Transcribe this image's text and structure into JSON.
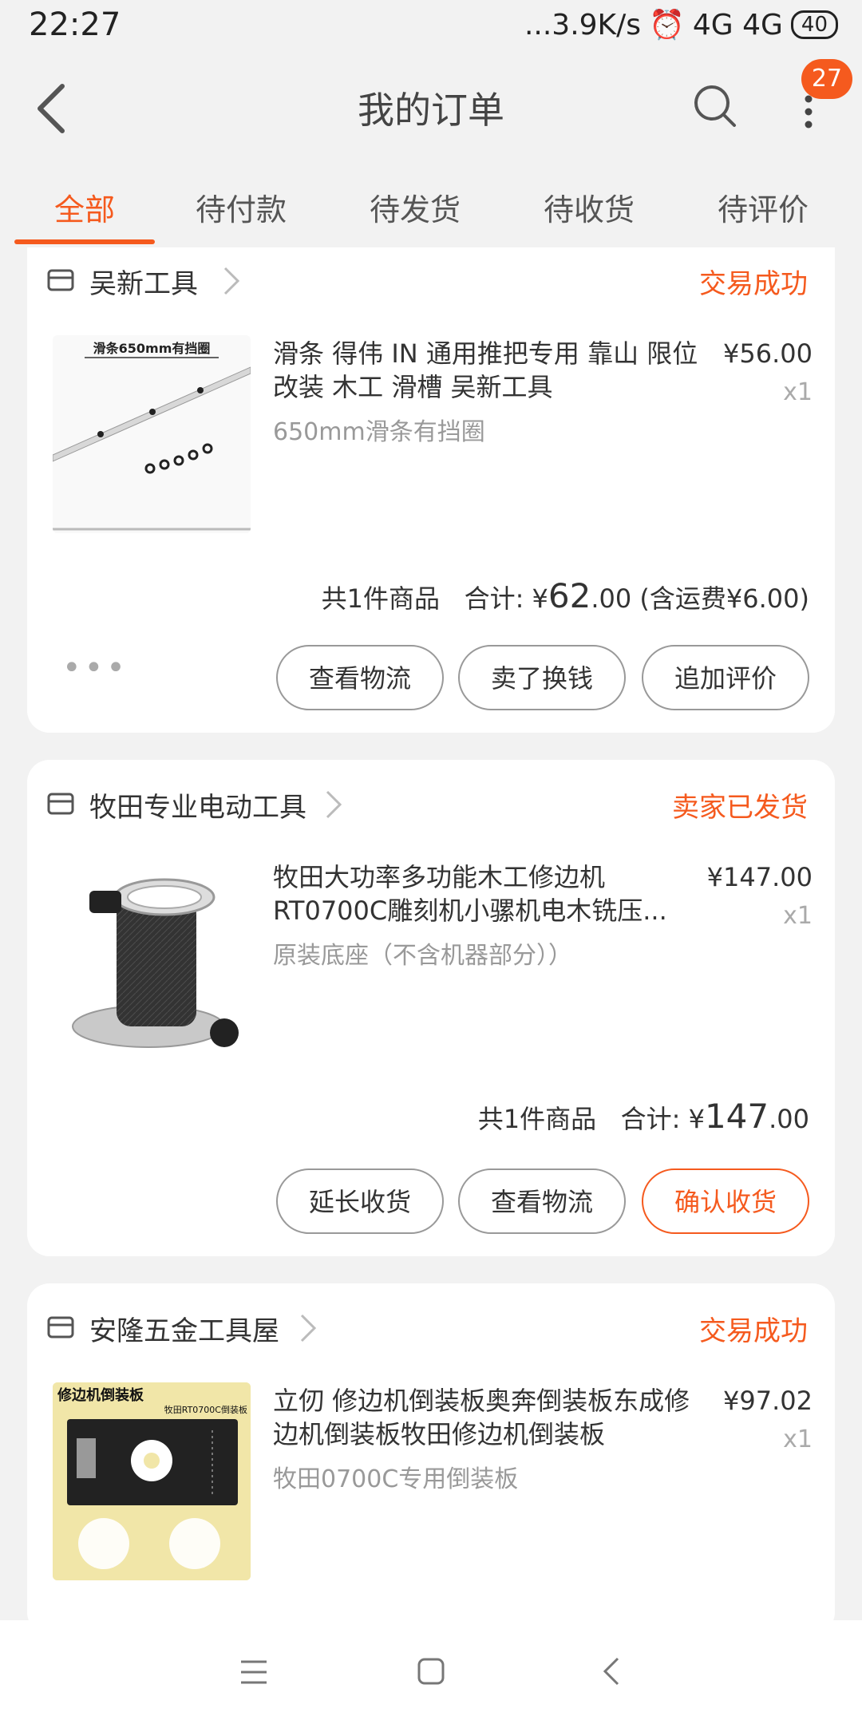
{
  "status_bar": {
    "time": "22:27",
    "network_speed": "...3.9K/s",
    "signal": "4G 4G",
    "battery": "40"
  },
  "header": {
    "title": "我的订单",
    "badge_count": "27"
  },
  "tabs": [
    {
      "label": "全部",
      "active": true
    },
    {
      "label": "待付款",
      "active": false
    },
    {
      "label": "待发货",
      "active": false
    },
    {
      "label": "待收货",
      "active": false
    },
    {
      "label": "待评价",
      "active": false
    }
  ],
  "orders": [
    {
      "shop": "吴新工具",
      "status": "交易成功",
      "title": "滑条 得伟 IN 通用推把专用 靠山 限位 改装 木工 滑槽 吴新工具",
      "sku": "650mm滑条有挡圈",
      "price": "¥56.00",
      "qty": "x1",
      "thumb_text": "滑条650mm有挡圈",
      "summary_count": "共1件商品",
      "summary_label": "合计:",
      "total_currency": "¥",
      "total_int": "62",
      "total_dec": ".00",
      "shipping": "(含运费¥6.00)",
      "more": "•••",
      "buttons": [
        "查看物流",
        "卖了换钱",
        "追加评价"
      ]
    },
    {
      "shop": "牧田专业电动工具",
      "status": "卖家已发货",
      "title": "牧田大功率多功能木工修边机RT0700C雕刻机小骡机电木铣压...",
      "sku": "原装底座（不含机器部分））",
      "price": "¥147.00",
      "qty": "x1",
      "summary_count": "共1件商品",
      "summary_label": "合计:",
      "total_currency": "¥",
      "total_int": "147",
      "total_dec": ".00",
      "buttons": [
        "延长收货",
        "查看物流",
        "确认收货"
      ]
    },
    {
      "shop": "安隆五金工具屋",
      "status": "交易成功",
      "title": "立仞 修边机倒装板奥奔倒装板东成修边机倒装板牧田修边机倒装板",
      "sku": "牧田0700C专用倒装板",
      "price": "¥97.02",
      "qty": "x1",
      "thumb_text": "修边机倒装板",
      "thumb_text2": "牧田RT0700C倒装板"
    }
  ],
  "colors": {
    "accent": "#f55a1e",
    "background": "#f2f2f2"
  }
}
